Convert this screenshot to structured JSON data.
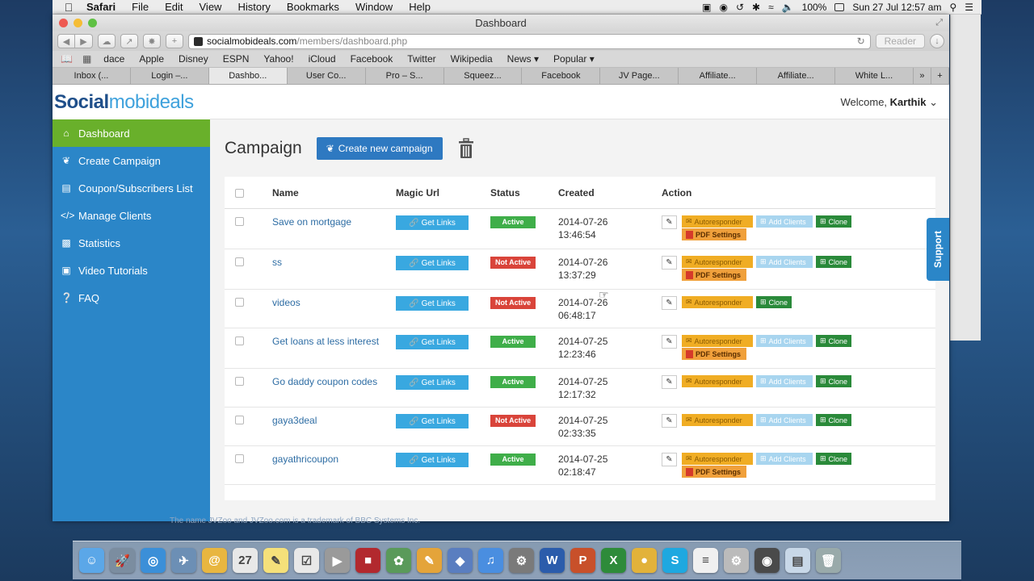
{
  "menubar": {
    "apple": "",
    "items": [
      "Safari",
      "File",
      "Edit",
      "View",
      "History",
      "Bookmarks",
      "Window",
      "Help"
    ],
    "battery": "100%",
    "clock": "Sun 27 Jul  12:57 am"
  },
  "window": {
    "title": "Dashboard",
    "url_host": "socialmobideals.com",
    "url_path": "/members/dashboard.php",
    "reader": "Reader"
  },
  "bookmarks": [
    "dace",
    "Apple",
    "Disney",
    "ESPN",
    "Yahoo!",
    "iCloud",
    "Facebook",
    "Twitter",
    "Wikipedia",
    "News ▾",
    "Popular ▾"
  ],
  "tabs": [
    "Inbox (...",
    "Login –...",
    "Dashbo...",
    "User Co...",
    "Pro – S...",
    "Squeez...",
    "Facebook",
    "JV Page...",
    "Affiliate...",
    "Affiliate...",
    "White L..."
  ],
  "logo": {
    "part1": "Social",
    "part2": "mobideals"
  },
  "sidebar": [
    {
      "label": "Dashboard",
      "icon": "home-icon"
    },
    {
      "label": "Create Campaign",
      "icon": "leaf-icon"
    },
    {
      "label": "Coupon/Subscribers List",
      "icon": "list-icon"
    },
    {
      "label": "Manage Clients",
      "icon": "code-icon"
    },
    {
      "label": "Statistics",
      "icon": "bar-chart-icon"
    },
    {
      "label": "Video Tutorials",
      "icon": "image-icon"
    },
    {
      "label": "FAQ",
      "icon": "question-icon"
    }
  ],
  "welcome": {
    "prefix": "Welcome,",
    "user": "Karthik"
  },
  "page": {
    "title": "Campaign",
    "create_label": "Create new campaign"
  },
  "columns": {
    "name": "Name",
    "magic": "Magic Url",
    "status": "Status",
    "created": "Created",
    "action": "Action"
  },
  "labels": {
    "get_links": "Get Links",
    "autoresponder": "Autoresponder",
    "add_clients": "Add Clients",
    "clone": "Clone",
    "pdf": "PDF Settings",
    "support": "Support"
  },
  "rows": [
    {
      "name": "Save on mortgage",
      "status": "Active",
      "date": "2014-07-26",
      "time": "13:46:54",
      "pdf": true
    },
    {
      "name": "ss",
      "status": "Not Active",
      "date": "2014-07-26",
      "time": "13:37:29",
      "pdf": true
    },
    {
      "name": "videos",
      "status": "Not Active",
      "date": "2014-07-26",
      "time": "06:48:17",
      "pdf": false
    },
    {
      "name": "Get loans at less interest",
      "status": "Active",
      "date": "2014-07-25",
      "time": "12:23:46",
      "pdf": true
    },
    {
      "name": "Go daddy coupon codes",
      "status": "Active",
      "date": "2014-07-25",
      "time": "12:17:32",
      "pdf": false
    },
    {
      "name": "gaya3deal",
      "status": "Not Active",
      "date": "2014-07-25",
      "time": "02:33:35",
      "pdf": false
    },
    {
      "name": "gayathricoupon",
      "status": "Active",
      "date": "2014-07-25",
      "time": "02:18:47",
      "pdf": true
    }
  ],
  "footer_note": "The name JVZoo and JVZoo.com is a trademark of BBC Systems Inc.",
  "dock": [
    "finder",
    "launchpad",
    "safari",
    "preview",
    "mail",
    "calendar",
    "notes",
    "reminders",
    "facetime",
    "photo-booth",
    "photos",
    "pages",
    "keynote",
    "itunes",
    "system-preferences",
    "word",
    "powerpoint",
    "excel",
    "chrome",
    "skype",
    "textedit",
    "automator",
    "image-capture",
    "documents",
    "trash"
  ]
}
